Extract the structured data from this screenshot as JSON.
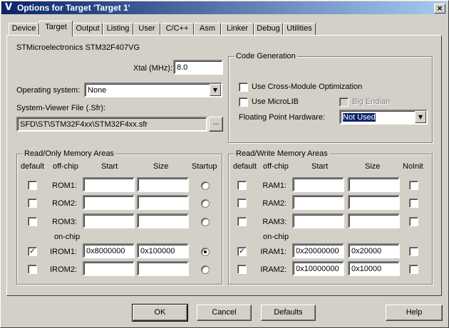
{
  "window": {
    "title": "Options for Target 'Target 1'",
    "icon": "keil-icon",
    "close_glyph": "×"
  },
  "tabs": [
    "Device",
    "Target",
    "Output",
    "Listing",
    "User",
    "C/C++",
    "Asm",
    "Linker",
    "Debug",
    "Utilities"
  ],
  "active_tab": "Target",
  "target": {
    "device": "STMicroelectronics STM32F407VG",
    "xtal_label": "Xtal (MHz):",
    "xtal_value": "8.0",
    "os_label": "Operating system:",
    "os_value": "None",
    "svf_label": "System-Viewer File (.Sfr):",
    "svf_value": "SFD\\ST\\STM32F4xx\\STM32F4xx.sfr",
    "browse_label": "..."
  },
  "code_gen": {
    "title": "Code Generation",
    "cross_module": {
      "label": "Use Cross-Module Optimization",
      "checked": false
    },
    "microlib": {
      "label": "Use MicroLIB",
      "checked": false
    },
    "big_endian": {
      "label": "Big Endian",
      "checked": false,
      "disabled": true
    },
    "fpu_label": "Floating Point Hardware:",
    "fpu_value": "Not Used"
  },
  "rom": {
    "title": "Read/Only Memory Areas",
    "headers": {
      "default": "default",
      "offchip": "off-chip",
      "start": "Start",
      "size": "Size",
      "last": "Startup"
    },
    "onchip_label": "on-chip",
    "rows": [
      {
        "name": "ROM1:",
        "default": false,
        "start": "",
        "size": "",
        "startup": false
      },
      {
        "name": "ROM2:",
        "default": false,
        "start": "",
        "size": "",
        "startup": false
      },
      {
        "name": "ROM3:",
        "default": false,
        "start": "",
        "size": "",
        "startup": false
      },
      {
        "name": "IROM1:",
        "default": true,
        "start": "0x8000000",
        "size": "0x100000",
        "startup": true
      },
      {
        "name": "IROM2:",
        "default": false,
        "start": "",
        "size": "",
        "startup": false
      }
    ]
  },
  "ram": {
    "title": "Read/Write Memory Areas",
    "headers": {
      "default": "default",
      "offchip": "off-chip",
      "start": "Start",
      "size": "Size",
      "last": "NoInit"
    },
    "onchip_label": "on-chip",
    "rows": [
      {
        "name": "RAM1:",
        "default": false,
        "start": "",
        "size": "",
        "noinit": false
      },
      {
        "name": "RAM2:",
        "default": false,
        "start": "",
        "size": "",
        "noinit": false
      },
      {
        "name": "RAM3:",
        "default": false,
        "start": "",
        "size": "",
        "noinit": false
      },
      {
        "name": "IRAM1:",
        "default": true,
        "start": "0x20000000",
        "size": "0x20000",
        "noinit": false
      },
      {
        "name": "IRAM2:",
        "default": false,
        "start": "0x10000000",
        "size": "0x10000",
        "noinit": false
      }
    ]
  },
  "buttons": {
    "ok": "OK",
    "cancel": "Cancel",
    "defaults": "Defaults",
    "help": "Help"
  },
  "check_glyph": "✓",
  "combo_arrow": "▼"
}
